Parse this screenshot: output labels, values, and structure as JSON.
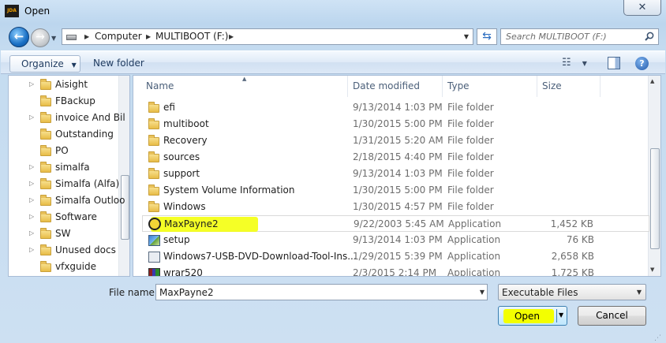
{
  "window": {
    "title": "Open",
    "app_icon_text": "JDA",
    "close_label": "✕"
  },
  "address": {
    "crumbs": [
      "Computer",
      "MULTIBOOT (F:)"
    ]
  },
  "search": {
    "placeholder": "Search MULTIBOOT (F:)"
  },
  "toolbar": {
    "organize_label": "Organize",
    "new_folder_label": "New folder"
  },
  "nav_items": [
    {
      "label": "Aisight",
      "expandable": true
    },
    {
      "label": "FBackup",
      "expandable": false
    },
    {
      "label": "invoice And Bil",
      "expandable": true
    },
    {
      "label": "Outstanding",
      "expandable": false
    },
    {
      "label": "PO",
      "expandable": false
    },
    {
      "label": "simalfa",
      "expandable": true
    },
    {
      "label": "Simalfa (Alfa)",
      "expandable": true
    },
    {
      "label": "Simalfa Outloo",
      "expandable": true
    },
    {
      "label": "Software",
      "expandable": true
    },
    {
      "label": "SW",
      "expandable": true
    },
    {
      "label": "Unused docs",
      "expandable": true
    },
    {
      "label": "vfxguide",
      "expandable": false
    }
  ],
  "columns": {
    "name": "Name",
    "date": "Date modified",
    "type": "Type",
    "size": "Size"
  },
  "files": [
    {
      "name": "efi",
      "date": "9/13/2014 1:03 PM",
      "type": "File folder",
      "size": "",
      "icon": "folder"
    },
    {
      "name": "multiboot",
      "date": "1/30/2015 5:00 PM",
      "type": "File folder",
      "size": "",
      "icon": "folder"
    },
    {
      "name": "Recovery",
      "date": "1/31/2015 5:20 AM",
      "type": "File folder",
      "size": "",
      "icon": "folder"
    },
    {
      "name": "sources",
      "date": "2/18/2015 4:40 PM",
      "type": "File folder",
      "size": "",
      "icon": "folder"
    },
    {
      "name": "support",
      "date": "9/13/2014 1:03 PM",
      "type": "File folder",
      "size": "",
      "icon": "folder"
    },
    {
      "name": "System Volume Information",
      "date": "1/30/2015 5:00 PM",
      "type": "File folder",
      "size": "",
      "icon": "folder"
    },
    {
      "name": "Windows",
      "date": "1/30/2015 4:57 PM",
      "type": "File folder",
      "size": "",
      "icon": "folder"
    },
    {
      "name": "MaxPayne2",
      "date": "9/22/2003 5:45 AM",
      "type": "Application",
      "size": "1,452 KB",
      "icon": "maxpayne",
      "selected": true,
      "highlighted": true
    },
    {
      "name": "setup",
      "date": "9/13/2014 1:03 PM",
      "type": "Application",
      "size": "76 KB",
      "icon": "setup"
    },
    {
      "name": "Windows7-USB-DVD-Download-Tool-Ins...",
      "date": "1/29/2015 5:39 PM",
      "type": "Application",
      "size": "2,658 KB",
      "icon": "installer"
    },
    {
      "name": "wrar520",
      "date": "2/3/2015 2:14 PM",
      "type": "Application",
      "size": "1,725 KB",
      "icon": "winrar"
    }
  ],
  "bottom": {
    "filename_label": "File name:",
    "filename_value": "MaxPayne2",
    "filter_value": "Executable Files",
    "open_label": "Open",
    "cancel_label": "Cancel"
  },
  "colors": {
    "highlight": "#f3ff00",
    "accent": "#3c7fb1"
  }
}
